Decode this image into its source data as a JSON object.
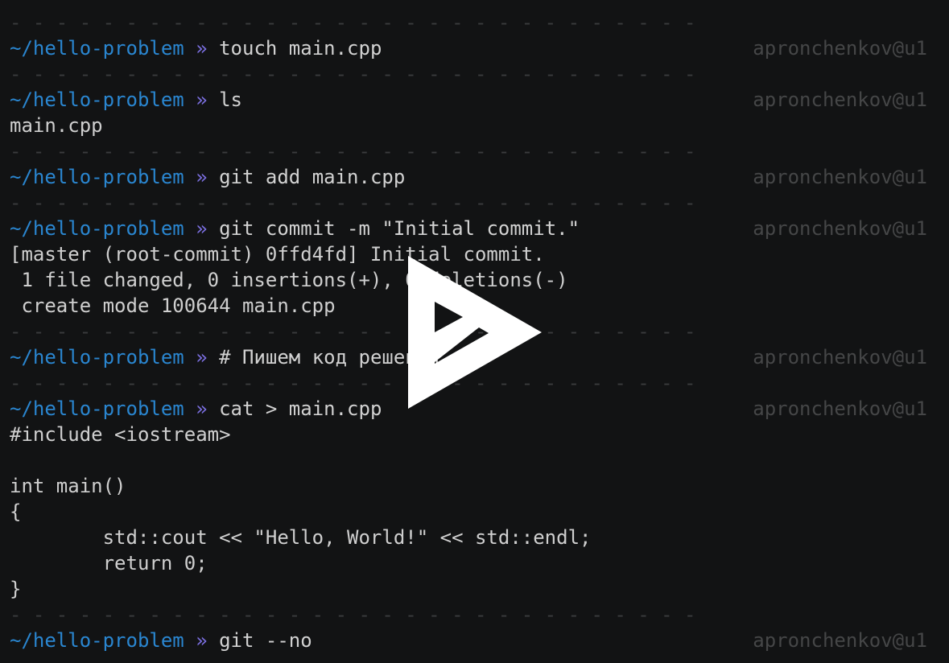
{
  "prompt": {
    "path": "~/hello-problem",
    "arrow": "»",
    "user_host": "apronchenkov@u1"
  },
  "separator": "- - - - - - - - - - - - - - - - - - - - - - - - - - - - - - - - - - - - - - - - - - - - - - - - - - - - - - - - - - - - - - - -",
  "commands": [
    {
      "cmd": "touch main.cpp",
      "output": []
    },
    {
      "cmd": "ls",
      "output": [
        "main.cpp"
      ]
    },
    {
      "cmd": "git add main.cpp",
      "output": []
    },
    {
      "cmd": "git commit -m \"Initial commit.\"",
      "output": [
        "[master (root-commit) 0ffd4fd] Initial commit.",
        " 1 file changed, 0 insertions(+), 0 deletions(-)",
        " create mode 100644 main.cpp"
      ]
    },
    {
      "cmd": "# Пишем код решения",
      "output": []
    },
    {
      "cmd": "cat > main.cpp",
      "output": [
        "#include <iostream>",
        "",
        "int main()",
        "{",
        "        std::cout << \"Hello, World!\" << std::endl;",
        "        return 0;",
        "}"
      ]
    },
    {
      "cmd": "git --no",
      "output": []
    }
  ],
  "overlay": {
    "icon": "asciinema-play-icon",
    "color": "#ffffff"
  }
}
